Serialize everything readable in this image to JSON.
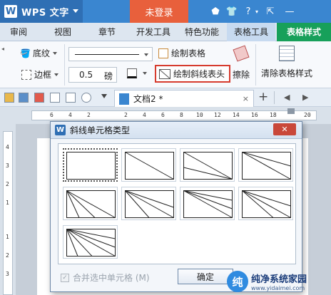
{
  "titlebar": {
    "app_name": "WPS 文字",
    "logo": "W",
    "login": "未登录",
    "help": "?",
    "minimize": "—"
  },
  "tabs": [
    "审阅",
    "视图",
    "章节",
    "开发工具",
    "特色功能",
    "表格工具",
    "表格样式"
  ],
  "ribbon": {
    "shading": "底纹",
    "border": "边框",
    "line_width": "0.5",
    "line_width_unit": "磅",
    "draw_table": "绘制表格",
    "draw_diagonal_header": "绘制斜线表头",
    "eraser": "擦除",
    "clear_style": "清除表格样式"
  },
  "quickbar": {
    "doc_tab": "文档2 *",
    "close": "×",
    "new_tab": "+"
  },
  "ruler": {
    "h": [
      "6",
      "4",
      "2",
      "2",
      "4",
      "6",
      "8",
      "10",
      "12",
      "14",
      "16",
      "18",
      "20"
    ],
    "v": [
      "4",
      "3",
      "2",
      "1",
      "1",
      "2",
      "3"
    ]
  },
  "dialog": {
    "title": "斜线单元格类型",
    "icon": "W",
    "close": "✕",
    "options": [
      "none",
      "1-line",
      "2-lines-right",
      "2-lines-left",
      "3-lines-a",
      "3-lines-b",
      "3-lines-c",
      "3-lines-d",
      "4-lines"
    ],
    "merge_label": "合并选中单元格 (M)",
    "ok": "确定"
  },
  "watermark": {
    "logo": "纯",
    "title": "纯净系统家园",
    "url": "www.yidaimei.com"
  },
  "colors": {
    "title_bar": "#3a86d0",
    "login": "#e8603c",
    "active_tab": "#17a05a",
    "highlight": "#d63b2e"
  }
}
